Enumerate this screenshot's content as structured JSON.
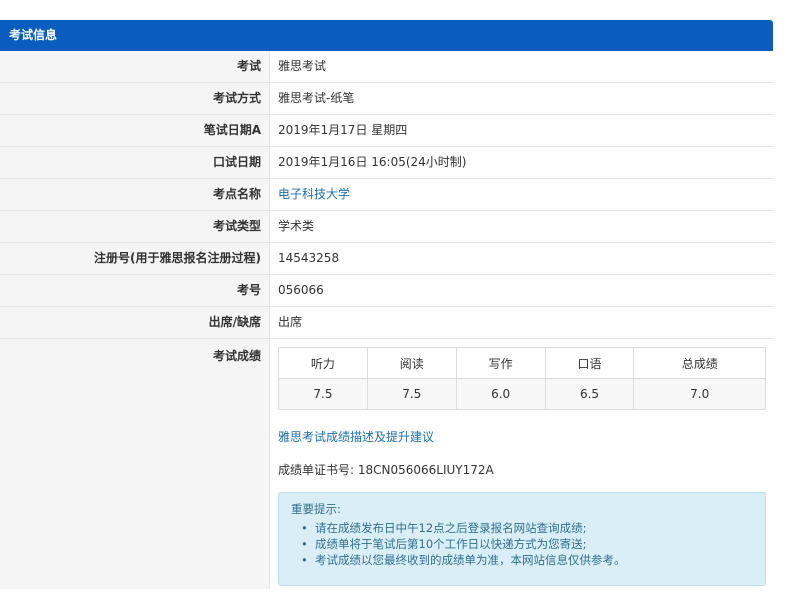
{
  "header": {
    "title": "考试信息"
  },
  "rows": [
    {
      "label": "考试",
      "value": "雅思考试"
    },
    {
      "label": "考试方式",
      "value": "雅思考试-纸笔"
    },
    {
      "label": "笔试日期A",
      "value": "2019年1月17日 星期四"
    },
    {
      "label": "口试日期",
      "value": "2019年1月16日 16:05(24小时制)"
    },
    {
      "label": "考点名称",
      "value": "电子科技大学"
    },
    {
      "label": "考试类型",
      "value": "学术类"
    },
    {
      "label": "注册号(用于雅思报名注册过程)",
      "value": "14543258"
    },
    {
      "label": "考号",
      "value": "056066"
    },
    {
      "label": "出席/缺席",
      "value": "出席"
    }
  ],
  "scores": {
    "label": "考试成绩",
    "headers": [
      "听力",
      "阅读",
      "写作",
      "口语",
      "总成绩"
    ],
    "values": [
      "7.5",
      "7.5",
      "6.0",
      "6.5",
      "7.0"
    ]
  },
  "score_link": "雅思考试成绩描述及提升建议",
  "certificate": "成绩单证书号: 18CN056066LIUY172A",
  "notice": {
    "title": "重要提示:",
    "bullet": "•",
    "items": [
      "请在成绩发布日中午12点之后登录报名网站查询成绩;",
      "成绩单将于笔试后第10个工作日以快递方式为您寄送;",
      "考试成绩以您最终收到的成绩单为准，本网站信息仅供参考。"
    ]
  },
  "colors": {
    "header_bg": "#0a5dbf",
    "link": "#1a6fb3",
    "notice_bg": "#d9eef7"
  }
}
